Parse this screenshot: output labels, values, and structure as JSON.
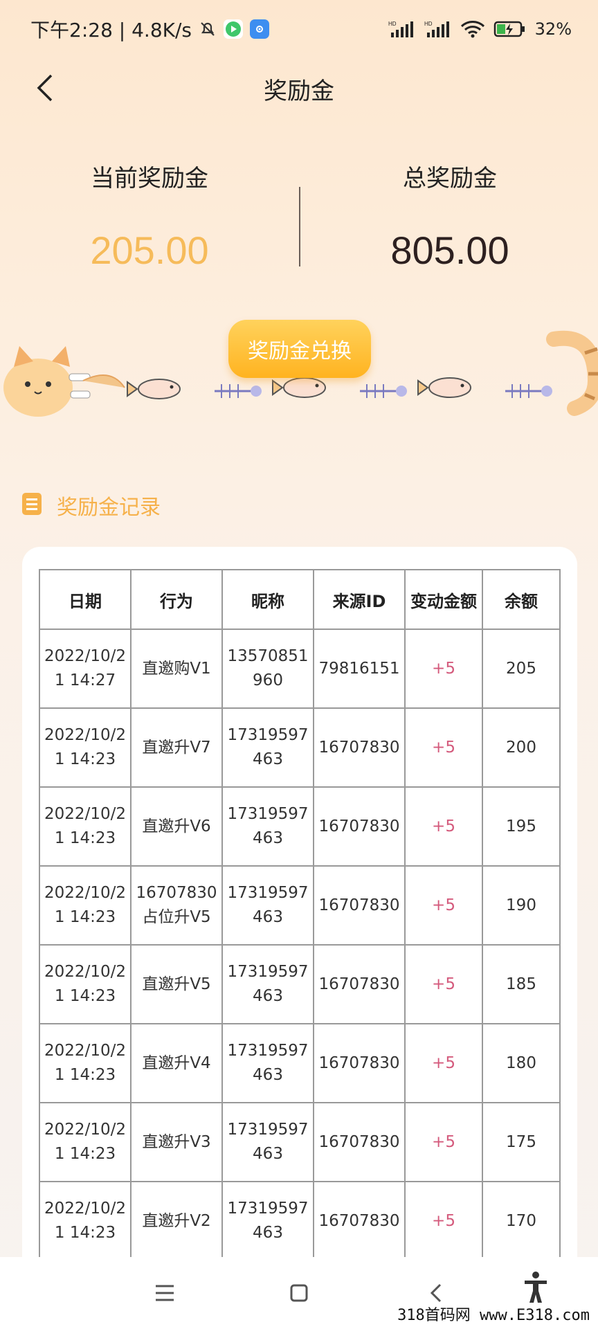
{
  "status_bar": {
    "time_speed": "下午2:28 | 4.8K/s",
    "battery": "32%",
    "network_label": "HD"
  },
  "header": {
    "title": "奖励金"
  },
  "summary": {
    "current_label": "当前奖励金",
    "current_value": "205.00",
    "total_label": "总奖励金",
    "total_value": "805.00"
  },
  "exchange_button": "奖励金兑换",
  "records": {
    "title": "奖励金记录",
    "columns": [
      "日期",
      "行为",
      "昵称",
      "来源ID",
      "变动金额",
      "余额"
    ],
    "rows": [
      {
        "date": "2022/10/21 14:27",
        "action": "直邀购V1",
        "nickname": "13570851960",
        "source_id": "79816151",
        "change": "+5",
        "balance": "205"
      },
      {
        "date": "2022/10/21 14:23",
        "action": "直邀升V7",
        "nickname": "17319597463",
        "source_id": "16707830",
        "change": "+5",
        "balance": "200"
      },
      {
        "date": "2022/10/21 14:23",
        "action": "直邀升V6",
        "nickname": "17319597463",
        "source_id": "16707830",
        "change": "+5",
        "balance": "195"
      },
      {
        "date": "2022/10/21 14:23",
        "action": "16707830占位升V5",
        "nickname": "17319597463",
        "source_id": "16707830",
        "change": "+5",
        "balance": "190"
      },
      {
        "date": "2022/10/21 14:23",
        "action": "直邀升V5",
        "nickname": "17319597463",
        "source_id": "16707830",
        "change": "+5",
        "balance": "185"
      },
      {
        "date": "2022/10/21 14:23",
        "action": "直邀升V4",
        "nickname": "17319597463",
        "source_id": "16707830",
        "change": "+5",
        "balance": "180"
      },
      {
        "date": "2022/10/21 14:23",
        "action": "直邀升V3",
        "nickname": "17319597463",
        "source_id": "16707830",
        "change": "+5",
        "balance": "175"
      },
      {
        "date": "2022/10/21 14:23",
        "action": "直邀升V2",
        "nickname": "17319597463",
        "source_id": "16707830",
        "change": "+5",
        "balance": "170"
      }
    ]
  },
  "watermark": "318首码网 www.E318.com",
  "colors": {
    "current_value": "#f6bb5a",
    "accent_orange": "#ffb320",
    "change_pink": "#d45a7c"
  }
}
